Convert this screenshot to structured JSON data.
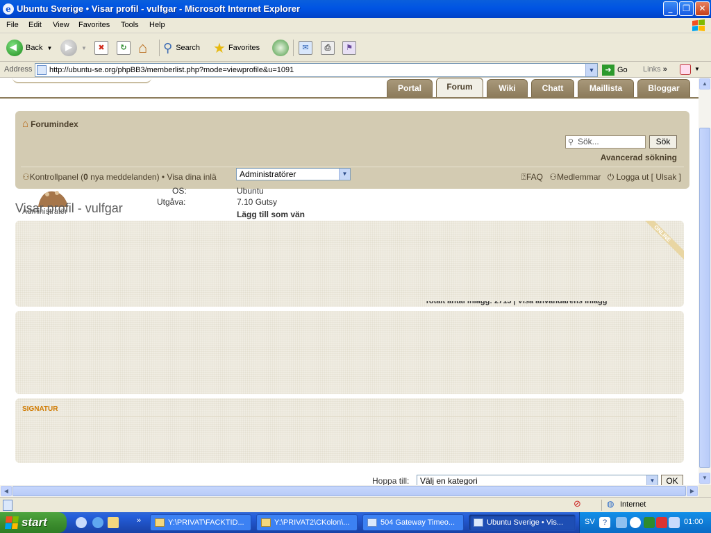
{
  "window": {
    "title": "Ubuntu Sverige • Visar profil - vulfgar - Microsoft Internet Explorer",
    "buttons": {
      "minimize": "_",
      "maximize": "❐",
      "close": "✕"
    }
  },
  "menu": [
    "File",
    "Edit",
    "View",
    "Favorites",
    "Tools",
    "Help"
  ],
  "toolbar": {
    "back": "Back",
    "search": "Search",
    "favorites": "Favorites"
  },
  "address": {
    "label": "Address",
    "url": "http://ubuntu-se.org/phpBB3/memberlist.php?mode=viewprofile&u=1091",
    "go": "Go",
    "links": "Links"
  },
  "site": {
    "tabs": [
      "Portal",
      "Forum",
      "Wiki",
      "Chatt",
      "Maillista",
      "Bloggar"
    ],
    "active_tab": "Forum",
    "forumindex": "Forumindex",
    "search_placeholder": "Sök...",
    "search_button": "Sök",
    "advanced_search": "Avancerad sökning",
    "ctrl_prefix": "Kontrollpanel (",
    "ctrl_count": "0",
    "ctrl_suffix": " nya meddelanden) • Visa dina inlä",
    "group_select": "Administratörer",
    "faq": "FAQ",
    "members": "Medlemmar",
    "logout": "Logga ut [ Ulsak ]"
  },
  "profile": {
    "page_title": "Visar profil - vulfgar",
    "avatar_caption": "Administratör",
    "os_label": "OS:",
    "os_value": "Ubuntu",
    "version_label": "Utgåva:",
    "version_value": "7.10 Gutsy",
    "add_friend": "Lägg till som vän",
    "online_badge": "ONLINE",
    "posts_overlap": "Totalt antal inlägg: 2713 | Visa användarens inlägg",
    "signature_title": "SIGNATUR"
  },
  "jump": {
    "label": "Hoppa till:",
    "select": "Välj en kategori",
    "ok": "OK"
  },
  "status": {
    "zone": "Internet"
  },
  "taskbar": {
    "start": "start",
    "tasks": [
      "Y:\\PRIVAT\\FACKTID...",
      "Y:\\PRIVAT2\\CKolon\\...",
      "504 Gateway Timeo...",
      "Ubuntu Sverige • Vis..."
    ],
    "active_task": 3,
    "lang": "SV",
    "clock": "01:00"
  }
}
